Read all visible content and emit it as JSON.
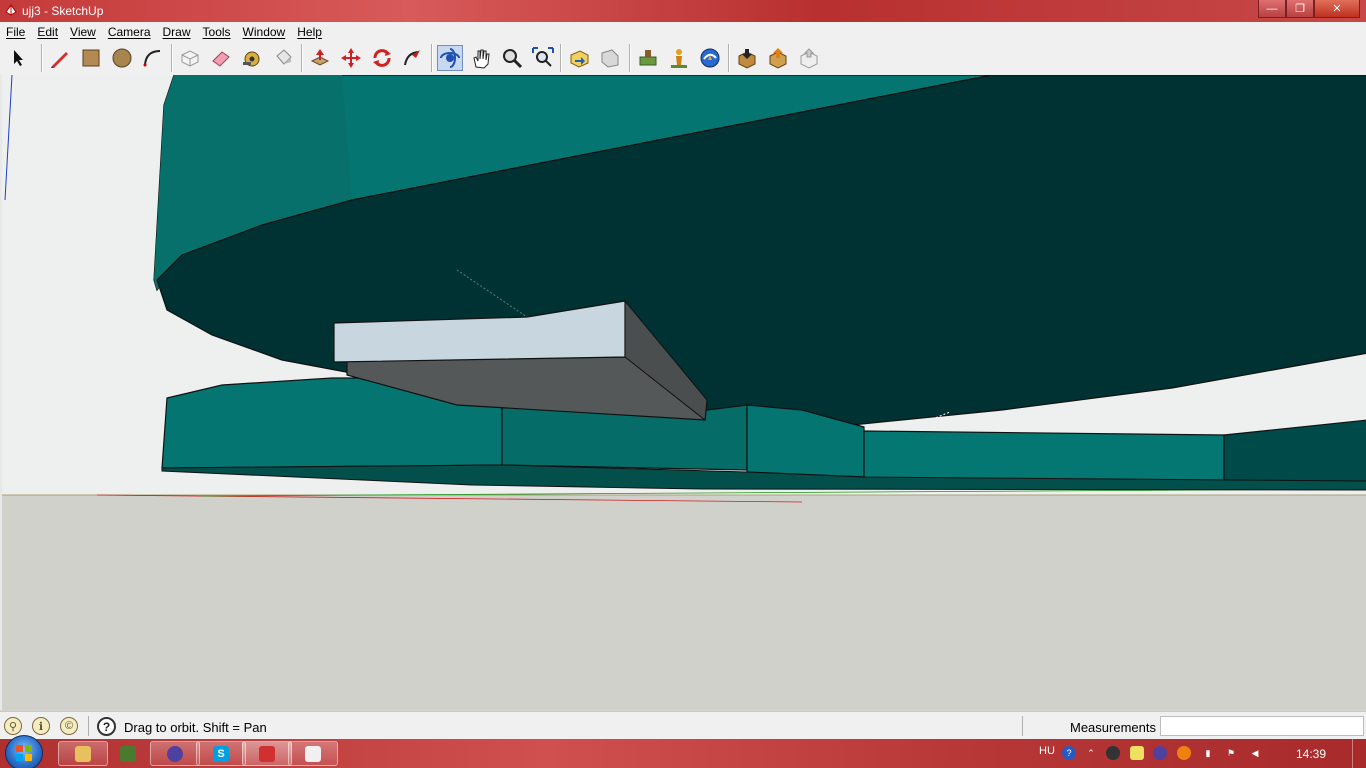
{
  "window": {
    "title": "ujj3 - SketchUp",
    "controls": {
      "minimize": "—",
      "maximize": "❐",
      "close": "✕"
    }
  },
  "menu": [
    {
      "id": "file",
      "label": "File"
    },
    {
      "id": "edit",
      "label": "Edit"
    },
    {
      "id": "view",
      "label": "View"
    },
    {
      "id": "camera",
      "label": "Camera"
    },
    {
      "id": "draw",
      "label": "Draw"
    },
    {
      "id": "tools",
      "label": "Tools"
    },
    {
      "id": "window",
      "label": "Window"
    },
    {
      "id": "help",
      "label": "Help"
    }
  ],
  "toolbar": {
    "groups": [
      [
        "select-tool-icon"
      ],
      [
        "pencil-line-tool-icon",
        "rectangle-tool-icon",
        "circle-tool-icon",
        "arc-tool-icon"
      ],
      [
        "make-component-icon",
        "eraser-tool-icon",
        "tape-measure-icon",
        "paint-bucket-icon"
      ],
      [
        "push-pull-tool-icon",
        "move-tool-icon",
        "rotate-tool-icon",
        "follow-me-icon"
      ],
      [
        "orbit-tool-icon",
        "pan-tool-icon",
        "zoom-tool-icon",
        "zoom-extents-icon"
      ],
      [
        "previous-view-icon",
        "next-view-icon"
      ],
      [
        "add-location-icon",
        "toggle-terrain-icon",
        "google-earth-icon"
      ],
      [
        "get-models-icon",
        "share-model-icon",
        "share-component-icon"
      ]
    ]
  },
  "statusbar": {
    "icons": [
      "geo-location-icon",
      "credits-icon",
      "copyright-icon"
    ],
    "help_glyph": "?",
    "hint": "Drag to orbit.  Shift = Pan",
    "measurements_label": "Measurements",
    "measurements_value": ""
  },
  "taskbar": {
    "apps": [
      "file-explorer-icon",
      "minecraft-icon",
      "browser-icon",
      "skype-icon",
      "sketchup-icon",
      "paint-icon"
    ],
    "skype_glyph": "S",
    "language": "HU",
    "tray_icons": [
      "help-icon",
      "steam-icon",
      "notes-icon",
      "browser-tray-icon",
      "avast-icon",
      "network-icon",
      "action-center-icon",
      "volume-icon"
    ],
    "clock": "14:39"
  },
  "colors": {
    "model_teal": "#047571",
    "model_dark_teal": "#003234",
    "model_light_face": "#c8d6df",
    "model_gray_face": "#545859",
    "sky": "#eef0ef",
    "ground": "#d1d1cb",
    "titlebar_red": "#c43a3a"
  }
}
